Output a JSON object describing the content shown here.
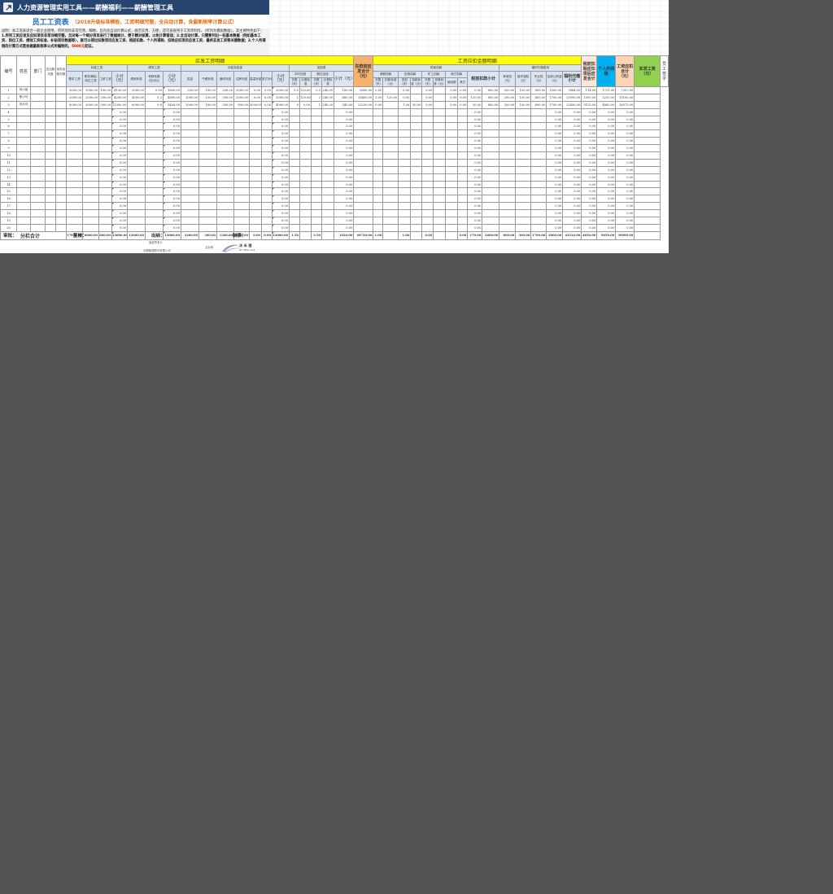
{
  "app": {
    "title": "人力资源管理实用工具——薪酬福利——薪酬管理工具",
    "sheet_title": "员工工资表",
    "sheet_subtitle": "（2018升级标准模板，工资明细完整，全自动计算，含最新税率计算公式）"
  },
  "description": {
    "p1": "说明：本工资表适合一般企业使用，所列项目非常完善、细致，且内含自动计算公式，规范实用、方便，还可直接用于工资单制作。（所列为模拟数据）。其主要特色如下：",
    "p2": "1.所列工资应发及应扣项目非常详细完整，且对每一个细分项目进行了数据统计，便于精对核算，以免计算错误；2.全自动计算，只需要列出一些基本数据（例如基本工资、岗位工资、绩效工资标准、补贴项目数据等），就可以得出扣款项目应发工资、税前扣款、个人所得税、扣除应扣项目应发工资、最终实发工资等关键数据；3.个人所得税的计算方式是依据最新税率公式所编制的，",
    "highlight": "5000元",
    "p3": "起征。"
  },
  "headers": {
    "seq": "编号",
    "name": "姓名",
    "dept": "部门",
    "should_days": "应出勤天数",
    "actual_days": "实际出勤天数",
    "gross_section": "应发工资明细",
    "deduct_section": "工资应扣金额明细",
    "std_wage": "标准工资",
    "perf_wage": "绩效工资",
    "allowance": "补贴及奖金",
    "overtime": "加班费",
    "basic_wage": "基本工资",
    "post_wage": "职务津贴/岗位工资",
    "seniority": "工龄工资",
    "subtotal": "小计（元）",
    "perf_std": "绩效标准",
    "perf_coef": "考核系数（百分比）",
    "bonus": "奖金",
    "lunch": "午餐补贴",
    "comm": "通讯补贴",
    "housing": "住房补贴",
    "high_temp": "高温补贴",
    "other_sub": "其它补贴",
    "weekday_ot": "平时加班",
    "holiday_ot": "假日加班",
    "days": "天数（天）",
    "ot_fee": "计费标准",
    "gross_total": "扣款前应发合计（元）",
    "pretax_deduct": "税前扣款",
    "leave_deduct": "请假扣款",
    "late_deduct": "迟到扣款",
    "absent_deduct": "旷工扣款",
    "other_deduct": "其它扣款",
    "leave_std": "扣款标准（元）",
    "late_times": "迟到（次）",
    "per_day": "扣款标准（元）",
    "use_fee": "使用费",
    "others": "其它",
    "pretax_subtotal": "税前扣款小计",
    "welfare": "福利代缴费用",
    "pension": "养老险（元）",
    "medical": "医疗保险（元）",
    "unemployment": "失业险（元）",
    "housing_fund": "住房公积金（元）",
    "welfare_subtotal": "福利代缴小计",
    "after_deduct": "税前扣除应扣项后应发合计",
    "tax": "个人所得税",
    "deduct_total": "工资应扣合计（元）",
    "net_pay": "实发工资（元）",
    "sign": "员工签字"
  },
  "rows": [
    {
      "no": "1",
      "name": "何小孩",
      "basic": "3000.00",
      "post": "1000.00",
      "sen": "100.00",
      "std_sub": "4100.00",
      "perf": "2000.00",
      "coef": "0.90",
      "perf_sub": "1800.00",
      "bonus": "200.00",
      "lunch": "100.00",
      "comm": "200.00",
      "housing": "2000.00",
      "hot": "0.00",
      "other": "0.00",
      "allow_sub": "2000.00",
      "wd_days": "0.5",
      "wd_fee": "120.00",
      "hd_days": "0.5",
      "hd_fee": "240.00",
      "ot_sub": "180.00",
      "gross": "8080.00",
      "leave_days": "0.00",
      "leave_std": "",
      "late": "0.00",
      "absent_days": "",
      "absent_amt": "0.00",
      "use_fee": "",
      "others": "0.00",
      "o2": "0.00",
      "pre_sub": "0.00",
      "pension": "800.00",
      "medical": "200.00",
      "unemp": "100.00",
      "fund": "600.00",
      "wel_sub": "1000.00",
      "after": "7484.00",
      "tax": "114.00",
      "deduct": "1721.00",
      "net": "7357.00"
    },
    {
      "no": "2",
      "name": "蔡小马",
      "basic": "2000.00",
      "post": "2000.00",
      "sen": "200.00",
      "std_sub": "4200.00",
      "perf": "4000.00",
      "coef": "1.2",
      "perf_sub": "4800.00",
      "bonus": "1000.00",
      "lunch": "100.00",
      "comm": "500.00",
      "housing": "2000.00",
      "hot": "0.00",
      "other": "0.00",
      "allow_sub": "2000.00",
      "wd_days": "1",
      "wd_fee": "120.00",
      "hd_days": "2",
      "hd_fee": "240.00",
      "ot_sub": "480.00",
      "gross": "16400.00",
      "leave_days": "1.00",
      "leave_std": "120.00",
      "late": "0.00",
      "absent_days": "",
      "absent_amt": "0.00",
      "use_fee": "",
      "others": "0.00",
      "o2": "0.00",
      "pre_sub": "120.00",
      "pension": "800.00",
      "medical": "200.00",
      "unemp": "100.00",
      "fund": "400.00",
      "wel_sub": "1700.00",
      "after": "13990.00",
      "tax": "1500.00",
      "deduct": "3210.00",
      "net": "13190.00"
    },
    {
      "no": "3",
      "name": "刘大马",
      "basic": "6000.00",
      "post": "3000.00",
      "sen": "300.00",
      "std_sub": "11300.00",
      "perf": "6000.00",
      "coef": "0.9",
      "perf_sub": "5400.00",
      "bonus": "2000.00",
      "lunch": "100.00",
      "comm": "500.00",
      "housing": "800.00",
      "hot": "3000.00",
      "other": "0.00",
      "allow_sub": "4000.00",
      "wd_days": "0",
      "wd_fee": "0.00",
      "hd_days": "1",
      "hd_fee": "240.00",
      "ot_sub": "240.00",
      "gross": "22230.00",
      "leave_days": "0.00",
      "leave_std": "",
      "late": "1.00",
      "absent_days": "50.00",
      "absent_amt": "0.00",
      "use_fee": "",
      "others": "0.00",
      "o2": "0.00",
      "pre_sub": "50.00",
      "pension": "800.00",
      "medical": "200.00",
      "unemp": "100.00",
      "fund": "600.00",
      "wel_sub": "1700.00",
      "after": "22490.00",
      "tax": "3115.00",
      "deduct": "4865.00",
      "net": "16572.00"
    }
  ],
  "blank_rows": [
    "4",
    "5",
    "6",
    "7",
    "8",
    "9",
    "10",
    "11",
    "12",
    "13",
    "14",
    "15",
    "16",
    "17",
    "18",
    "19",
    "20"
  ],
  "zero": "0.00",
  "totals": {
    "label": "分栏合计",
    "basic": "17000.00",
    "post": "6000.00",
    "sen": "600.00",
    "std_sub": "23600.00",
    "perf": "12000.00",
    "perf_sub": "12000.00",
    "bonus": "3200.00",
    "lunch": "300.00",
    "comm": "1200.00",
    "housing": "4800.00",
    "hot": "0.00",
    "other": "0.00",
    "allow_sub": "12000.00",
    "wd_days": "1.50",
    "hd_days": "3.50",
    "ot_sub": "1020.00",
    "gross": "49720.00",
    "leave_days": "1.00",
    "late": "1.00",
    "absent_amt": "0.00",
    "o2": "0.00",
    "pre_sub": "170.00",
    "pension": "2400.00",
    "medical": "600.00",
    "unemp": "300.00",
    "fund": "1700.00",
    "wel_sub": "3000.00",
    "after": "43516.00",
    "tax": "4656.00",
    "deduct": "9659.00",
    "net": "39099.00"
  },
  "footer": {
    "approve": "审批：",
    "review": "复核：",
    "cashier": "出纳：",
    "maker": "制表：",
    "copyright": "版权所有©",
    "company": "长腾管理顾问有限公司",
    "studio": "北京禾",
    "logo_cn": "沐 禾 理",
    "logo_en": "MU HENG WUJI"
  },
  "colors": {
    "title_bar": "#27466f",
    "header_yellow": "#ffff00",
    "tax_cyan": "#00b0f0",
    "net_green": "#92d050",
    "gross_orange": "#f6b26b"
  }
}
